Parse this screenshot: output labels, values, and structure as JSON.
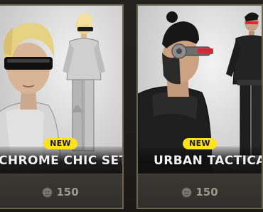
{
  "cards": [
    {
      "badge": "NEW",
      "name": "CHROME CHIC SET",
      "price": "150",
      "currency_icon": "coin-icon"
    },
    {
      "badge": "NEW",
      "name": "URBAN TACTICAL S",
      "price": "150",
      "currency_icon": "coin-icon"
    }
  ],
  "colors": {
    "badge_bg": "#ffe31a",
    "card_border": "#6b6550",
    "price_text": "#9c988d"
  }
}
